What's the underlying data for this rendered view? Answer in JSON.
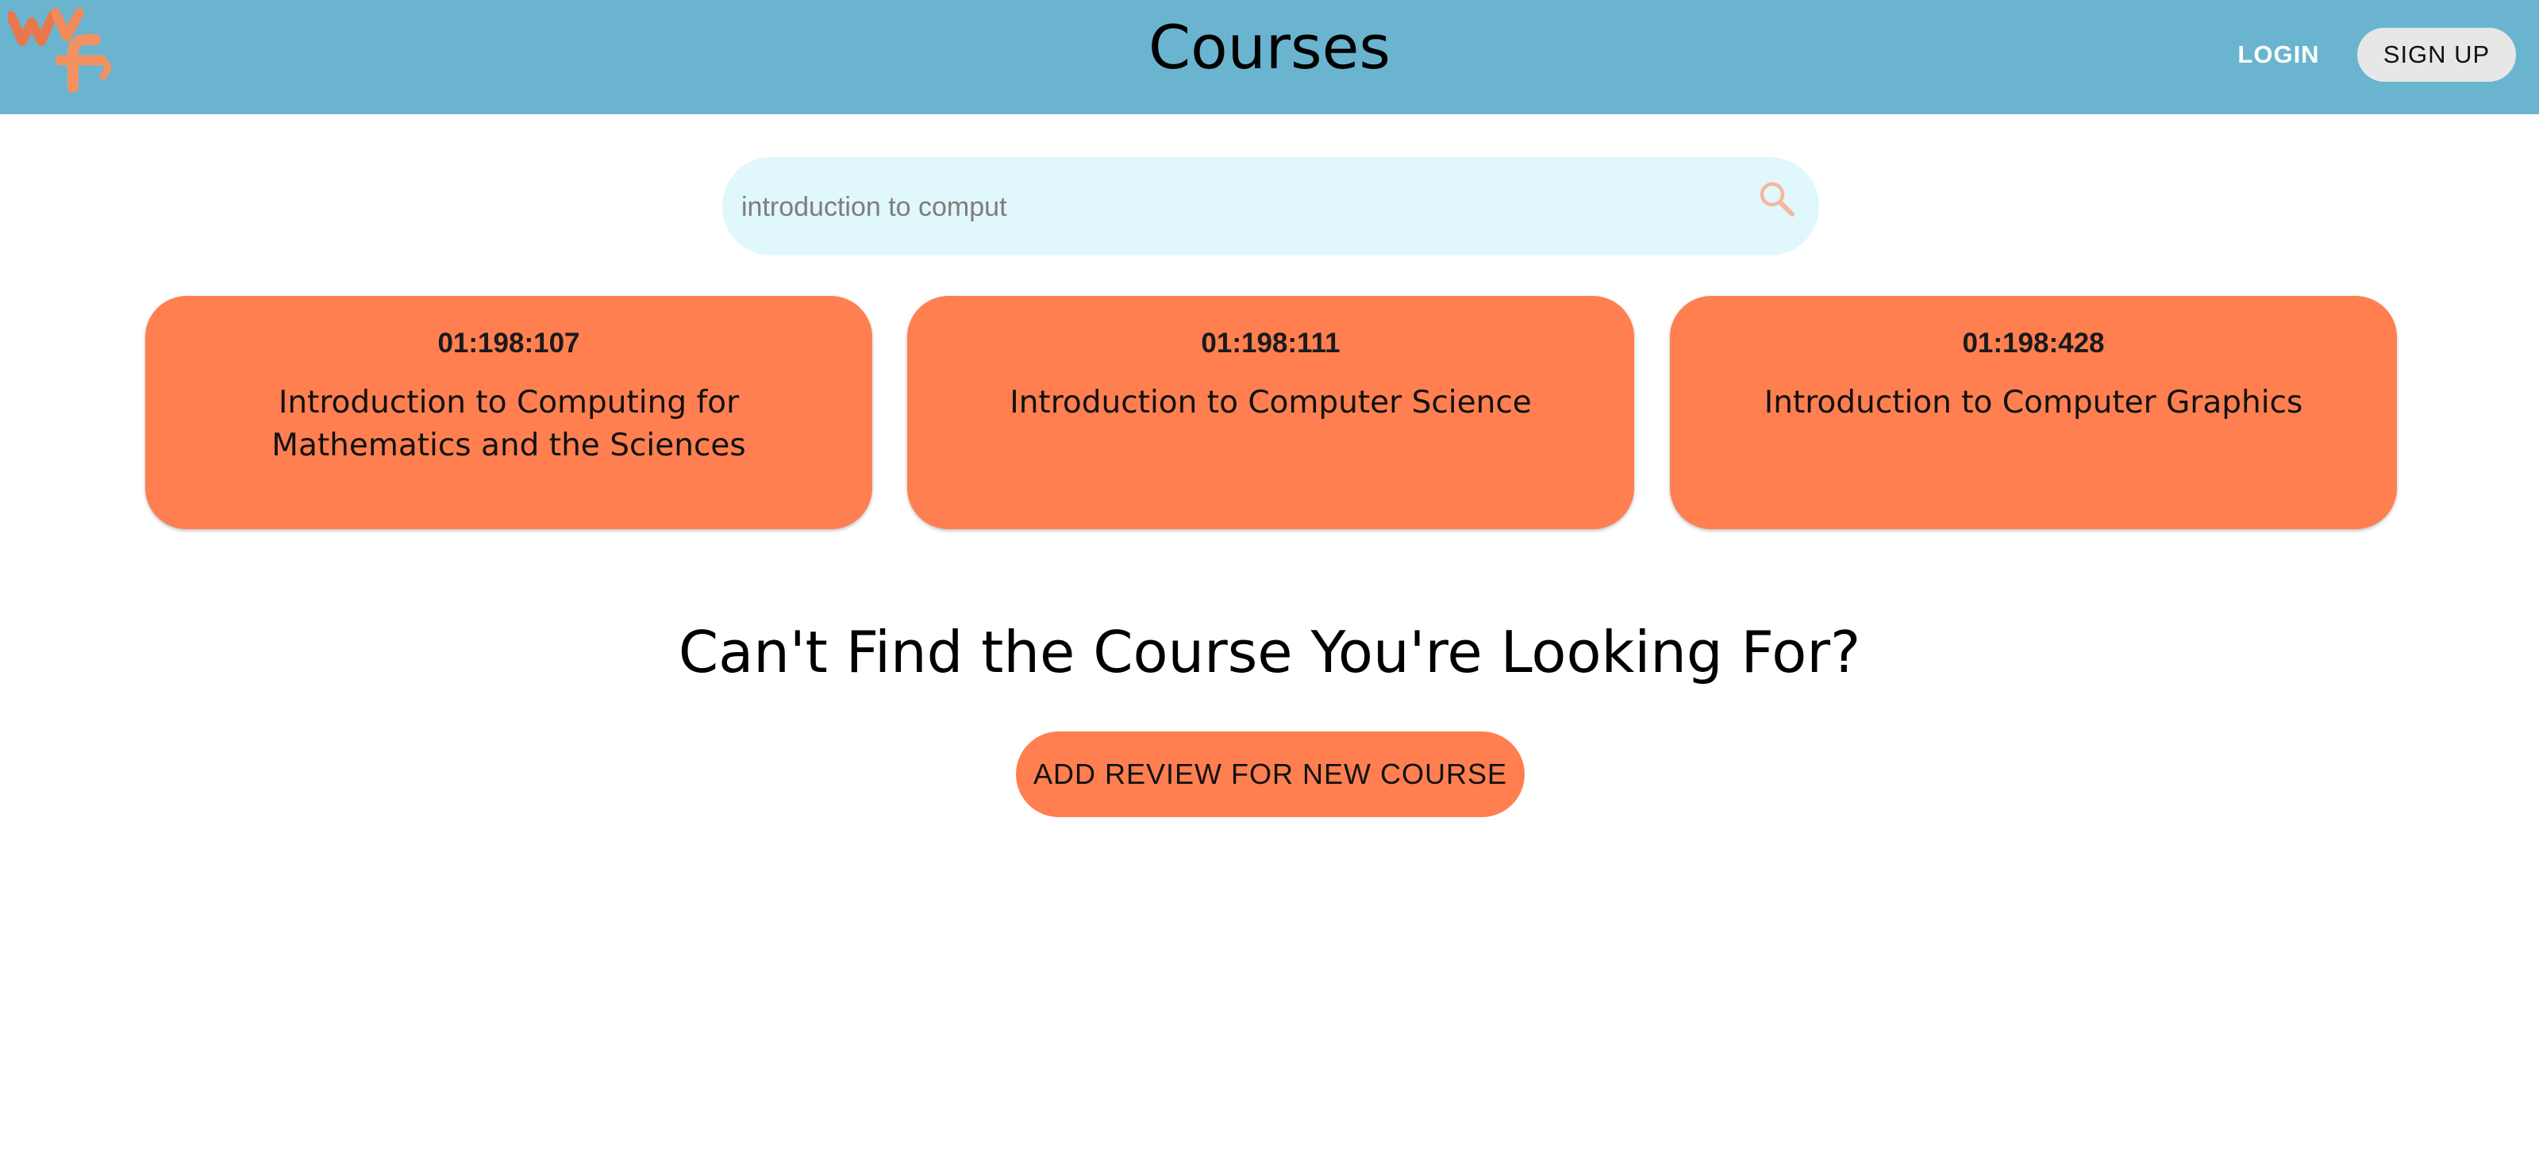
{
  "header": {
    "title": "Courses",
    "login_label": "LOGIN",
    "signup_label": "SIGN UP",
    "background_color": "#6ab4d0",
    "logo_icon": "wf-logo-icon"
  },
  "search": {
    "value": "introduction to comput",
    "icon": "search-icon",
    "background_color": "#e0f7fb"
  },
  "courses": [
    {
      "code": "01:198:107",
      "title": "Introduction to Computing for Mathematics and the Sciences"
    },
    {
      "code": "01:198:111",
      "title": "Introduction to Computer Science"
    },
    {
      "code": "01:198:428",
      "title": "Introduction to Computer Graphics"
    }
  ],
  "cta": {
    "heading": "Can't Find the Course You're Looking For?",
    "button_label": "ADD REVIEW FOR NEW COURSE"
  },
  "colors": {
    "accent": "#ff7f50",
    "signup_button": "#e7e7e7"
  }
}
